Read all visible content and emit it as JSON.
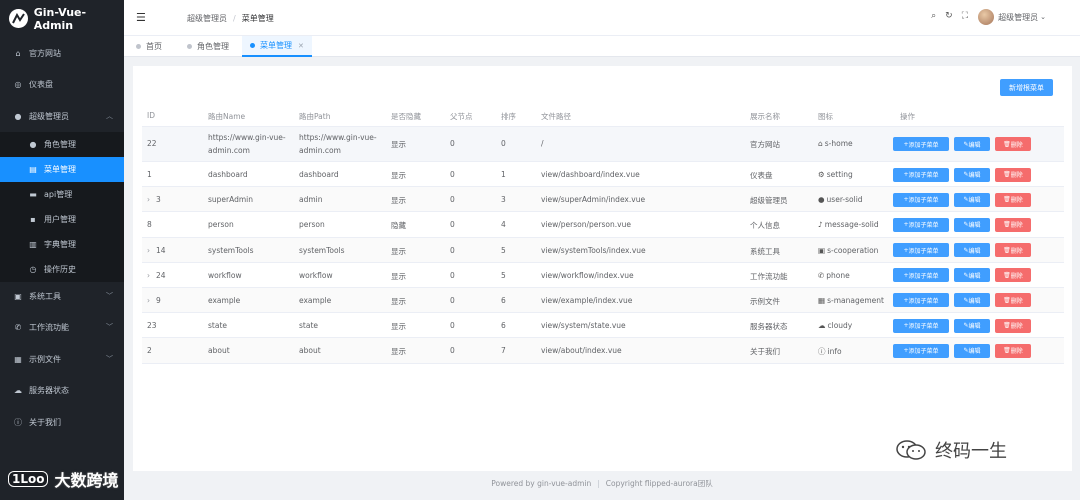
{
  "app": {
    "title": "Gin-Vue-Admin"
  },
  "sidebar": {
    "items": [
      {
        "label": "官方网站",
        "icon": "home-icon"
      },
      {
        "label": "仪表盘",
        "icon": "gauge-icon"
      },
      {
        "label": "超级管理员",
        "icon": "user-icon",
        "expanded": true
      },
      {
        "label": "系统工具",
        "icon": "briefcase-icon"
      },
      {
        "label": "工作流功能",
        "icon": "phone-icon"
      },
      {
        "label": "示例文件",
        "icon": "grid-icon"
      },
      {
        "label": "服务器状态",
        "icon": "cloud-icon"
      },
      {
        "label": "关于我们",
        "icon": "info-icon"
      }
    ],
    "sub_items": [
      {
        "label": "角色管理",
        "icon": "user-icon"
      },
      {
        "label": "菜单管理",
        "icon": "document-icon",
        "active": true
      },
      {
        "label": "api管理",
        "icon": "monitor-icon"
      },
      {
        "label": "用户管理",
        "icon": "user-icon"
      },
      {
        "label": "字典管理",
        "icon": "notebook-icon"
      },
      {
        "label": "操作历史",
        "icon": "clock-icon"
      }
    ]
  },
  "header": {
    "breadcrumb": [
      "超级管理员",
      "菜单管理"
    ],
    "user_name": "超级管理员"
  },
  "tabs": [
    {
      "label": "首页"
    },
    {
      "label": "角色管理"
    },
    {
      "label": "菜单管理",
      "active": true
    }
  ],
  "toolbar": {
    "new_root_label": "新增根菜单"
  },
  "table": {
    "columns": [
      "ID",
      "路由Name",
      "路由Path",
      "是否隐藏",
      "父节点",
      "排序",
      "文件路径",
      "展示名称",
      "图标",
      "操作"
    ],
    "rows": [
      {
        "id": "22",
        "name": "https://www.gin-vue-admin.com",
        "path": "https://www.gin-vue-admin.com",
        "hidden": "显示",
        "parent": "0",
        "sort": "0",
        "file": "/",
        "title": "官方网站",
        "icon": "s-home",
        "icon_name": "home-icon",
        "expandable": false
      },
      {
        "id": "1",
        "name": "dashboard",
        "path": "dashboard",
        "hidden": "显示",
        "parent": "0",
        "sort": "1",
        "file": "view/dashboard/index.vue",
        "title": "仪表盘",
        "icon": "setting",
        "icon_name": "gear-icon",
        "expandable": false
      },
      {
        "id": "3",
        "name": "superAdmin",
        "path": "admin",
        "hidden": "显示",
        "parent": "0",
        "sort": "3",
        "file": "view/superAdmin/index.vue",
        "title": "超级管理员",
        "icon": "user-solid",
        "icon_name": "user-icon",
        "expandable": true
      },
      {
        "id": "8",
        "name": "person",
        "path": "person",
        "hidden": "隐藏",
        "parent": "0",
        "sort": "4",
        "file": "view/person/person.vue",
        "title": "个人信息",
        "icon": "message-solid",
        "icon_name": "bell-icon",
        "expandable": false
      },
      {
        "id": "14",
        "name": "systemTools",
        "path": "systemTools",
        "hidden": "显示",
        "parent": "0",
        "sort": "5",
        "file": "view/systemTools/index.vue",
        "title": "系统工具",
        "icon": "s-cooperation",
        "icon_name": "briefcase-icon",
        "expandable": true
      },
      {
        "id": "24",
        "name": "workflow",
        "path": "workflow",
        "hidden": "显示",
        "parent": "0",
        "sort": "5",
        "file": "view/workflow/index.vue",
        "title": "工作流功能",
        "icon": "phone",
        "icon_name": "phone-icon",
        "expandable": true
      },
      {
        "id": "9",
        "name": "example",
        "path": "example",
        "hidden": "显示",
        "parent": "0",
        "sort": "6",
        "file": "view/example/index.vue",
        "title": "示例文件",
        "icon": "s-management",
        "icon_name": "grid-icon",
        "expandable": true
      },
      {
        "id": "23",
        "name": "state",
        "path": "state",
        "hidden": "显示",
        "parent": "0",
        "sort": "6",
        "file": "view/system/state.vue",
        "title": "服务器状态",
        "icon": "cloudy",
        "icon_name": "cloud-icon",
        "expandable": false
      },
      {
        "id": "2",
        "name": "about",
        "path": "about",
        "hidden": "显示",
        "parent": "0",
        "sort": "7",
        "file": "view/about/index.vue",
        "title": "关于我们",
        "icon": "info",
        "icon_name": "info-icon",
        "expandable": false
      }
    ],
    "actions": {
      "add_child": "添加子菜单",
      "edit": "编辑",
      "delete": "删除"
    }
  },
  "footer": {
    "powered": "Powered by gin-vue-admin",
    "copyright": "Copyright flipped-aurora团队"
  },
  "watermarks": {
    "left_badge": "1Loo",
    "left_text": "大数跨境",
    "right_text": "终码一生"
  }
}
